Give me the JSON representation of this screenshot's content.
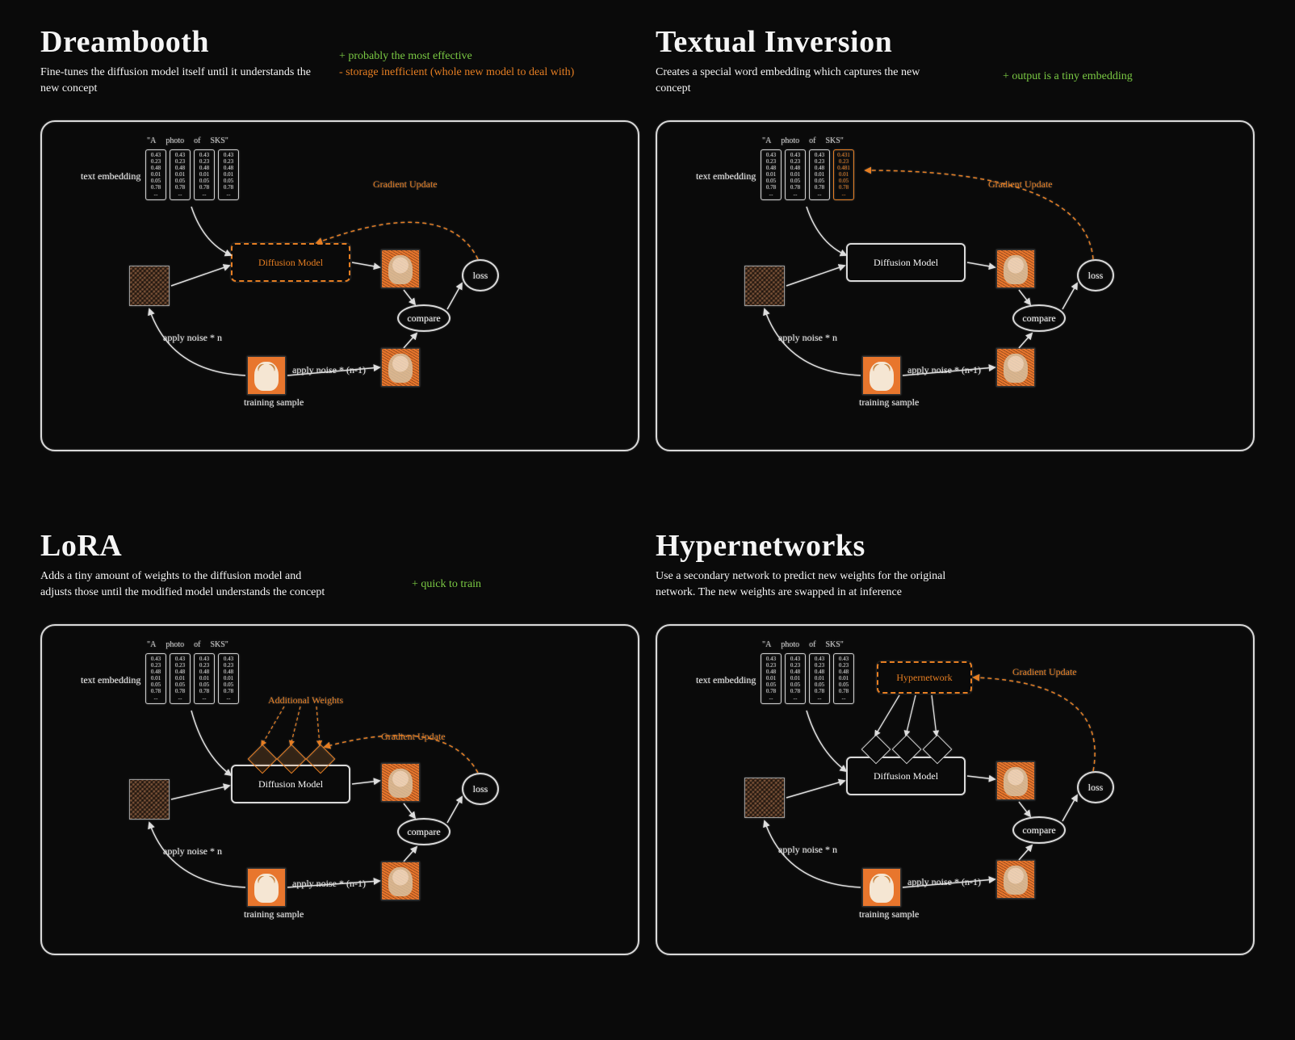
{
  "panels": {
    "dreambooth": {
      "title": "Dreambooth",
      "desc": "Fine-tunes the diffusion model itself until it understands the new concept",
      "pro": "+ probably the most effective",
      "con": "- storage inefficient (whole new model to deal with)"
    },
    "textual_inversion": {
      "title": "Textual Inversion",
      "desc": "Creates a special word embedding which captures the new concept",
      "pro": "+ output is a tiny embedding"
    },
    "lora": {
      "title": "LoRA",
      "desc": "Adds a tiny amount of weights to the diffusion model and adjusts those until the modified model understands the concept",
      "pro": "+ quick to train"
    },
    "hypernetworks": {
      "title": "Hypernetworks",
      "desc": "Use a secondary network to predict new weights for the original network. The new weights are swapped in at inference"
    }
  },
  "diagram": {
    "text_embedding_label": "text embedding",
    "prompt": [
      "\"A",
      "photo",
      "of",
      "SKS\""
    ],
    "embedding_values": [
      "0.43",
      "0.23",
      "0.48",
      "0.01",
      "0.05",
      "0.78",
      "..."
    ],
    "diffusion_model": "Diffusion Model",
    "gradient_update": "Gradient Update",
    "apply_noise_n": "apply noise * n",
    "apply_noise_n1": "apply noise * (n-1)",
    "training_sample": "training sample",
    "compare": "compare",
    "loss": "loss",
    "additional_weights": "Additional Weights",
    "hypernetwork": "Hypernetwork"
  }
}
